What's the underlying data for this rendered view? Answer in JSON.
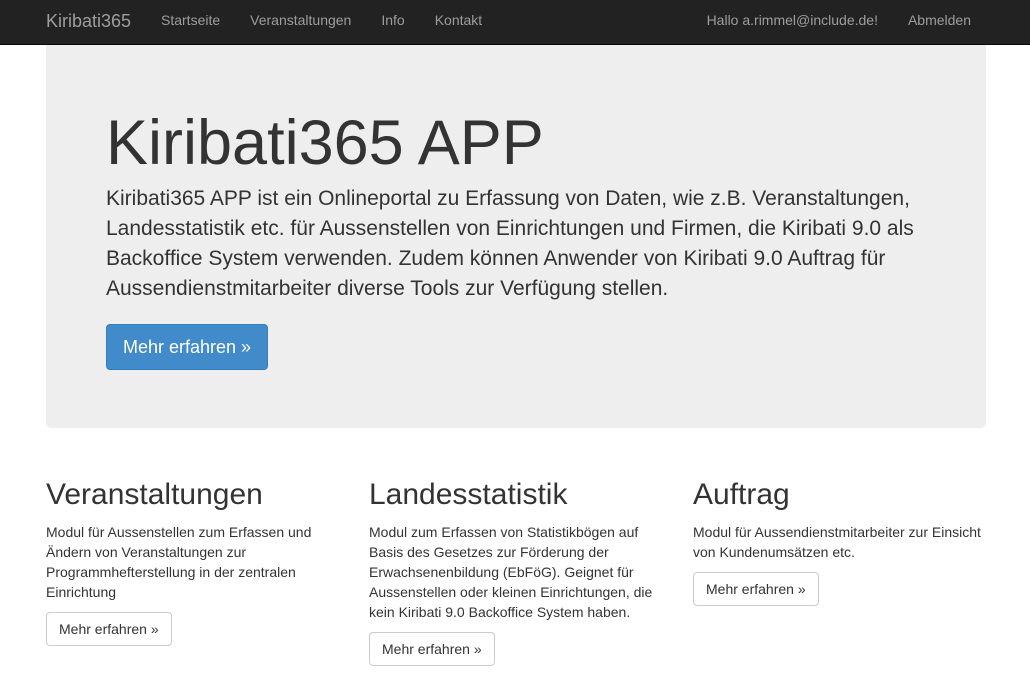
{
  "navbar": {
    "brand": "Kiribati365",
    "left_items": [
      "Startseite",
      "Veranstaltungen",
      "Info",
      "Kontakt"
    ],
    "greeting": "Hallo a.rimmel@include.de!",
    "logout": "Abmelden"
  },
  "jumbotron": {
    "title": "Kiribati365 APP",
    "lead": "Kiribati365 APP ist ein Onlineportal zu Erfassung von Daten, wie z.B. Veranstaltungen, Landesstatistik etc. für Aussenstellen von Einrichtungen und Firmen, die Kiribati 9.0 als Backoffice System verwenden. Zudem können Anwender von Kiribati 9.0 Auftrag für Aussendienstmitarbeiter diverse Tools zur Verfügung stellen.",
    "button": "Mehr erfahren »"
  },
  "columns": [
    {
      "heading": "Veranstaltungen",
      "text": "Modul für Aussenstellen zum Erfassen und Ändern von Veranstaltungen zur Programmhefterstellung in der zentralen Einrichtung",
      "button": "Mehr erfahren »"
    },
    {
      "heading": "Landesstatistik",
      "text": "Modul zum Erfassen von Statistikbögen auf Basis des Gesetzes zur Förderung der Erwachsenenbildung (EbFöG). Geignet für Aussenstellen oder kleinen Einrichtungen, die kein Kiribati 9.0 Backoffice System haben.",
      "button": "Mehr erfahren »"
    },
    {
      "heading": "Auftrag",
      "text": "Modul für Aussendienstmitarbeiter zur Einsicht von Kundenumsätzen etc.",
      "button": "Mehr erfahren »"
    }
  ],
  "colors": {
    "navbar_bg": "#222222",
    "nav_text": "#9d9d9d",
    "jumbotron_bg": "#eeeeee",
    "primary": "#428bca"
  }
}
